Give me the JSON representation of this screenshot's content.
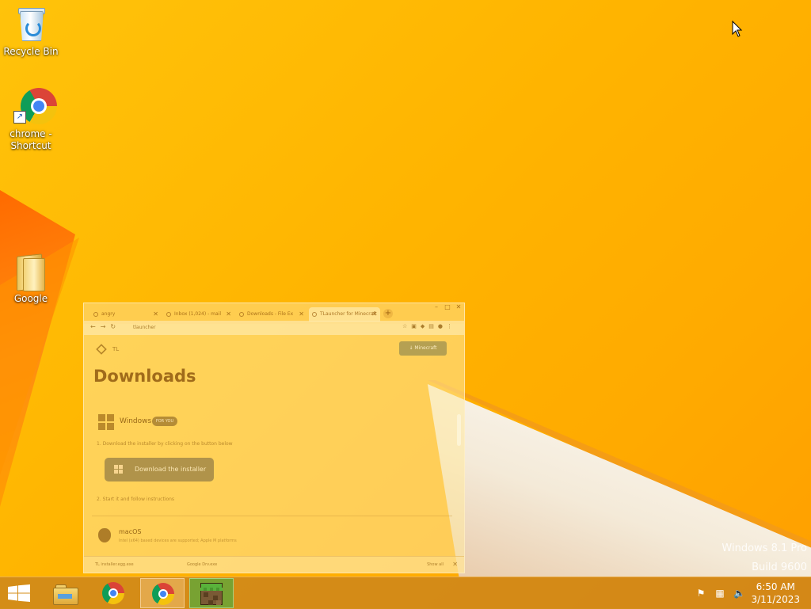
{
  "desktop": {
    "icons": [
      {
        "label": "Recycle Bin"
      },
      {
        "label": "chrome - Shortcut"
      },
      {
        "label": "Google"
      }
    ]
  },
  "window_preview": {
    "tabs": [
      {
        "label": "angry"
      },
      {
        "label": "Inbox (1,024) - mail"
      },
      {
        "label": "Downloads - File Ex"
      },
      {
        "label": "TLauncher for Minecraft"
      }
    ],
    "url": "tlauncher",
    "site_logo": "TL",
    "minecraft_button": "↓ Minecraft",
    "heading": "Downloads",
    "windows_label": "Windows",
    "for_you_badge": "FOR YOU",
    "step1": "1. Download the installer by clicking on the button below",
    "download_button": "Download the installer",
    "step2": "2. Start it and follow instructions",
    "macos_label": "macOS",
    "macos_sub": "Intel (x64) based devices are supported; Apple M platforms",
    "download_bar": {
      "file1": "TL installer.egg.exe",
      "file2": "Google Drv.exe",
      "show_all": "Show all"
    }
  },
  "watermark": {
    "line1": "Windows 8.1 Pro",
    "line2": "Build 9600"
  },
  "taskbar": {
    "clock_time": "6:50 AM",
    "clock_date": "3/11/2023"
  },
  "colors": {
    "background": "#ffb400",
    "taskbar": "#c8821e"
  }
}
